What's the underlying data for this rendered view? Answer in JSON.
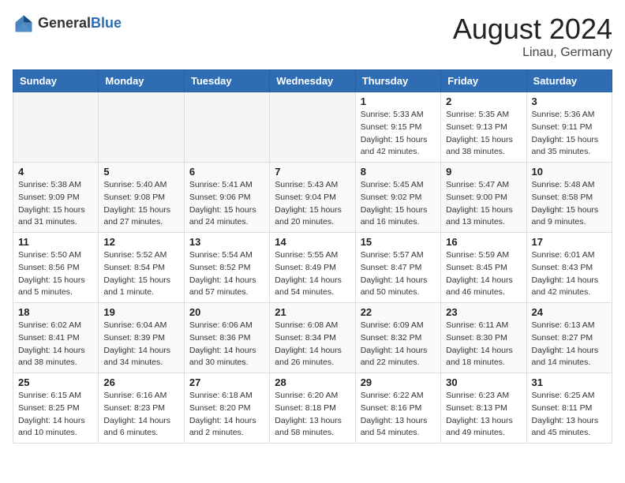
{
  "header": {
    "logo_general": "General",
    "logo_blue": "Blue",
    "month_title": "August 2024",
    "location": "Linau, Germany"
  },
  "weekdays": [
    "Sunday",
    "Monday",
    "Tuesday",
    "Wednesday",
    "Thursday",
    "Friday",
    "Saturday"
  ],
  "weeks": [
    [
      {
        "day": "",
        "empty": true
      },
      {
        "day": "",
        "empty": true
      },
      {
        "day": "",
        "empty": true
      },
      {
        "day": "",
        "empty": true
      },
      {
        "day": "1",
        "sunrise": "5:33 AM",
        "sunset": "9:15 PM",
        "daylight": "15 hours and 42 minutes."
      },
      {
        "day": "2",
        "sunrise": "5:35 AM",
        "sunset": "9:13 PM",
        "daylight": "15 hours and 38 minutes."
      },
      {
        "day": "3",
        "sunrise": "5:36 AM",
        "sunset": "9:11 PM",
        "daylight": "15 hours and 35 minutes."
      }
    ],
    [
      {
        "day": "4",
        "sunrise": "5:38 AM",
        "sunset": "9:09 PM",
        "daylight": "15 hours and 31 minutes."
      },
      {
        "day": "5",
        "sunrise": "5:40 AM",
        "sunset": "9:08 PM",
        "daylight": "15 hours and 27 minutes."
      },
      {
        "day": "6",
        "sunrise": "5:41 AM",
        "sunset": "9:06 PM",
        "daylight": "15 hours and 24 minutes."
      },
      {
        "day": "7",
        "sunrise": "5:43 AM",
        "sunset": "9:04 PM",
        "daylight": "15 hours and 20 minutes."
      },
      {
        "day": "8",
        "sunrise": "5:45 AM",
        "sunset": "9:02 PM",
        "daylight": "15 hours and 16 minutes."
      },
      {
        "day": "9",
        "sunrise": "5:47 AM",
        "sunset": "9:00 PM",
        "daylight": "15 hours and 13 minutes."
      },
      {
        "day": "10",
        "sunrise": "5:48 AM",
        "sunset": "8:58 PM",
        "daylight": "15 hours and 9 minutes."
      }
    ],
    [
      {
        "day": "11",
        "sunrise": "5:50 AM",
        "sunset": "8:56 PM",
        "daylight": "15 hours and 5 minutes."
      },
      {
        "day": "12",
        "sunrise": "5:52 AM",
        "sunset": "8:54 PM",
        "daylight": "15 hours and 1 minute."
      },
      {
        "day": "13",
        "sunrise": "5:54 AM",
        "sunset": "8:52 PM",
        "daylight": "14 hours and 57 minutes."
      },
      {
        "day": "14",
        "sunrise": "5:55 AM",
        "sunset": "8:49 PM",
        "daylight": "14 hours and 54 minutes."
      },
      {
        "day": "15",
        "sunrise": "5:57 AM",
        "sunset": "8:47 PM",
        "daylight": "14 hours and 50 minutes."
      },
      {
        "day": "16",
        "sunrise": "5:59 AM",
        "sunset": "8:45 PM",
        "daylight": "14 hours and 46 minutes."
      },
      {
        "day": "17",
        "sunrise": "6:01 AM",
        "sunset": "8:43 PM",
        "daylight": "14 hours and 42 minutes."
      }
    ],
    [
      {
        "day": "18",
        "sunrise": "6:02 AM",
        "sunset": "8:41 PM",
        "daylight": "14 hours and 38 minutes."
      },
      {
        "day": "19",
        "sunrise": "6:04 AM",
        "sunset": "8:39 PM",
        "daylight": "14 hours and 34 minutes."
      },
      {
        "day": "20",
        "sunrise": "6:06 AM",
        "sunset": "8:36 PM",
        "daylight": "14 hours and 30 minutes."
      },
      {
        "day": "21",
        "sunrise": "6:08 AM",
        "sunset": "8:34 PM",
        "daylight": "14 hours and 26 minutes."
      },
      {
        "day": "22",
        "sunrise": "6:09 AM",
        "sunset": "8:32 PM",
        "daylight": "14 hours and 22 minutes."
      },
      {
        "day": "23",
        "sunrise": "6:11 AM",
        "sunset": "8:30 PM",
        "daylight": "14 hours and 18 minutes."
      },
      {
        "day": "24",
        "sunrise": "6:13 AM",
        "sunset": "8:27 PM",
        "daylight": "14 hours and 14 minutes."
      }
    ],
    [
      {
        "day": "25",
        "sunrise": "6:15 AM",
        "sunset": "8:25 PM",
        "daylight": "14 hours and 10 minutes."
      },
      {
        "day": "26",
        "sunrise": "6:16 AM",
        "sunset": "8:23 PM",
        "daylight": "14 hours and 6 minutes."
      },
      {
        "day": "27",
        "sunrise": "6:18 AM",
        "sunset": "8:20 PM",
        "daylight": "14 hours and 2 minutes."
      },
      {
        "day": "28",
        "sunrise": "6:20 AM",
        "sunset": "8:18 PM",
        "daylight": "13 hours and 58 minutes."
      },
      {
        "day": "29",
        "sunrise": "6:22 AM",
        "sunset": "8:16 PM",
        "daylight": "13 hours and 54 minutes."
      },
      {
        "day": "30",
        "sunrise": "6:23 AM",
        "sunset": "8:13 PM",
        "daylight": "13 hours and 49 minutes."
      },
      {
        "day": "31",
        "sunrise": "6:25 AM",
        "sunset": "8:11 PM",
        "daylight": "13 hours and 45 minutes."
      }
    ]
  ]
}
